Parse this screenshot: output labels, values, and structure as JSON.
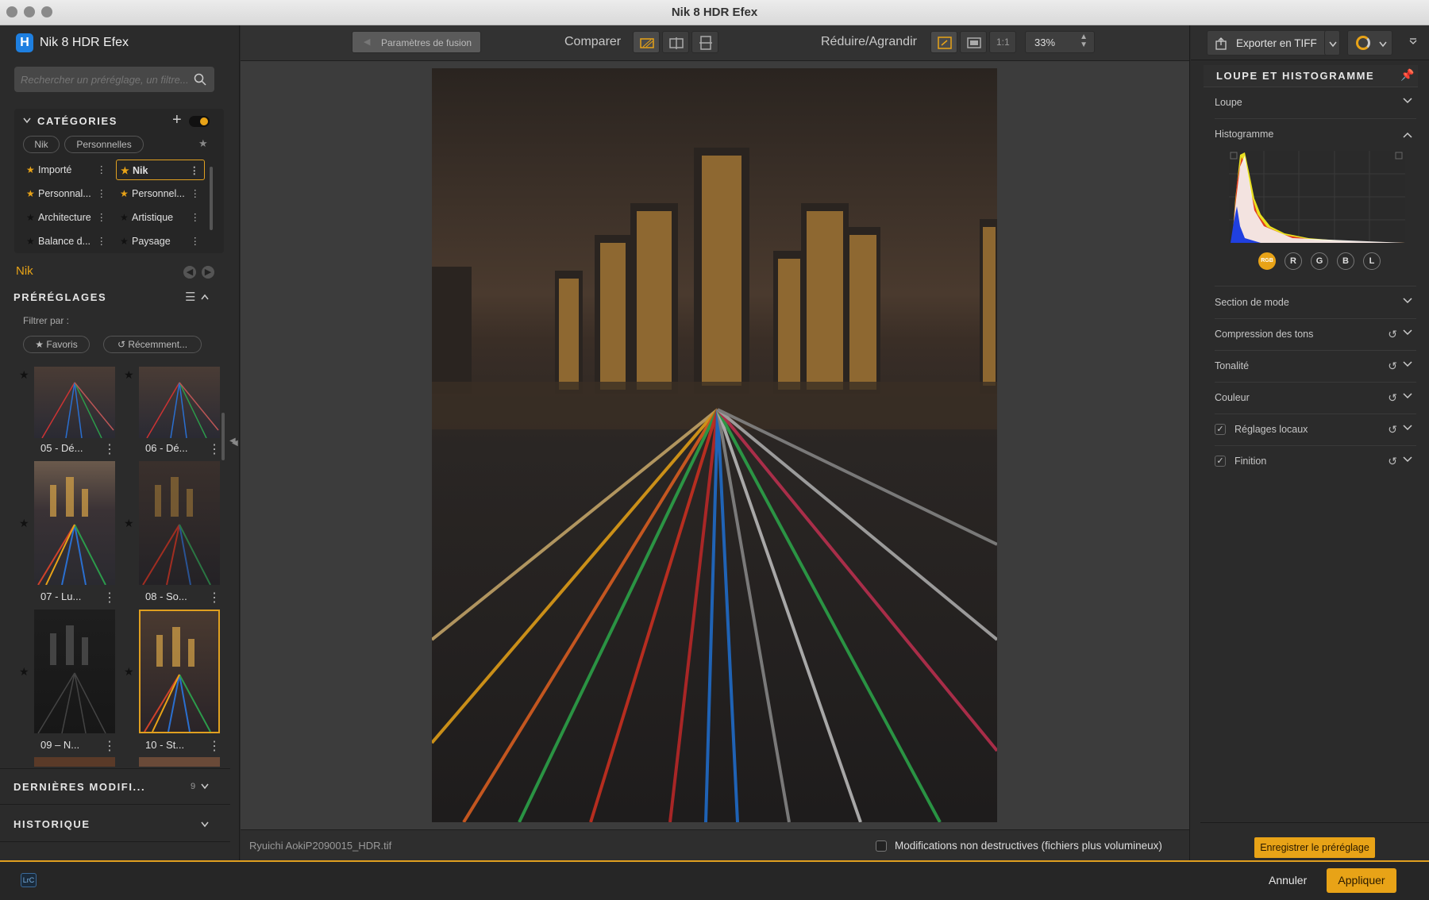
{
  "window": {
    "title": "Nik 8 HDR Efex"
  },
  "app": {
    "name": "Nik 8 HDR Efex",
    "logo_letter": "H"
  },
  "search": {
    "placeholder": "Rechercher un préréglage, un filtre..."
  },
  "categories": {
    "header": "CATÉGORIES",
    "tags": [
      "Nik",
      "Personnelles"
    ],
    "items": [
      {
        "label": "Importé",
        "starred": true
      },
      {
        "label": "Nik",
        "starred": true,
        "selected": true
      },
      {
        "label": "Personnal...",
        "starred": true
      },
      {
        "label": "Personnel...",
        "starred": true
      },
      {
        "label": "Architecture",
        "starred": false
      },
      {
        "label": "Artistique",
        "starred": false
      },
      {
        "label": "Balance d...",
        "starred": false
      },
      {
        "label": "Paysage",
        "starred": false
      }
    ]
  },
  "current_category": "Nik",
  "presets": {
    "header": "PRÉRÉGLAGES",
    "filter_label": "Filtrer par :",
    "filters": [
      "Favoris",
      "Récemment..."
    ],
    "items": [
      {
        "label": "05 - Dé..."
      },
      {
        "label": "06 - Dé..."
      },
      {
        "label": "07 - Lu..."
      },
      {
        "label": "08 - So..."
      },
      {
        "label": "09 – N..."
      },
      {
        "label": "10 - St...",
        "selected": true
      }
    ]
  },
  "recent_changes": {
    "header": "DERNIÈRES MODIFI...",
    "count": "9"
  },
  "history": {
    "header": "HISTORIQUE"
  },
  "toolbar": {
    "fusion_button": "Paramètres de fusion",
    "compare_label": "Comparer",
    "zoom_label": "Réduire/Agrandir",
    "one_to_one": "1:1",
    "zoom_value": "33%",
    "export_label": "Exporter en TIFF"
  },
  "status": {
    "filename": "Ryuichi AokiP2090015_HDR.tif",
    "nondestructive_label": "Modifications non destructives (fichiers plus volumineux)"
  },
  "right_panel": {
    "header": "LOUPE ET HISTOGRAMME",
    "loupe": "Loupe",
    "histogram": "Histogramme",
    "channels": [
      "RGB",
      "R",
      "G",
      "B",
      "L"
    ],
    "sections": [
      "Section de mode",
      "Compression des tons",
      "Tonalité",
      "Couleur",
      "Réglages locaux",
      "Finition"
    ],
    "save_preset": "Enregistrer le préréglage"
  },
  "footer": {
    "lrc_badge": "LrC",
    "cancel": "Annuler",
    "apply": "Appliquer"
  },
  "colors": {
    "accent": "#e8a317",
    "selection": "#e0a020"
  }
}
